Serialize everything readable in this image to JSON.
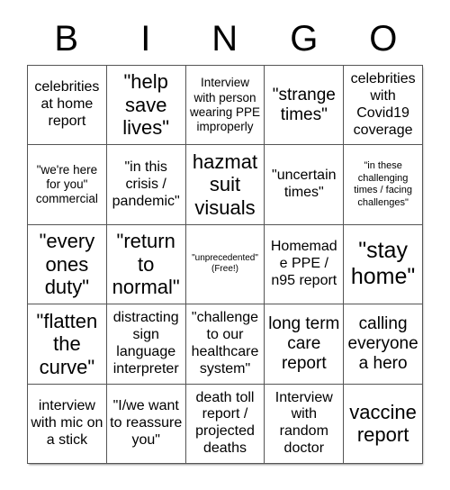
{
  "card": {
    "title": "BINGO",
    "header": {
      "letters": [
        "B",
        "I",
        "N",
        "G",
        "O"
      ]
    },
    "colors": {
      "background": "#ffffff",
      "text": "#000000",
      "border": "#555555"
    },
    "grid": {
      "columns": 5,
      "rows": 5,
      "free_space_index": 12,
      "cells": [
        {
          "text": "celebrities at home report",
          "size": "md",
          "free": false
        },
        {
          "text": "\"help save lives\"",
          "size": "xl",
          "free": false
        },
        {
          "text": "Interview with person wearing PPE improperly",
          "size": "sm",
          "free": false
        },
        {
          "text": "\"strange times\"",
          "size": "lg",
          "free": false
        },
        {
          "text": "celebrities with Covid19 coverage",
          "size": "md",
          "free": false
        },
        {
          "text": "\"we're here for you\" commercial",
          "size": "sm",
          "free": false
        },
        {
          "text": "\"in this crisis / pandemic\"",
          "size": "md",
          "free": false
        },
        {
          "text": "hazmat suit visuals",
          "size": "xl",
          "free": false
        },
        {
          "text": "\"uncertain times\"",
          "size": "md",
          "free": false
        },
        {
          "text": "\"in these challenging times / facing challenges\"",
          "size": "xs",
          "free": false
        },
        {
          "text": "\"every ones duty\"",
          "size": "xl",
          "free": false
        },
        {
          "text": "\"return to normal\"",
          "size": "xl",
          "free": false
        },
        {
          "text": "\"unprecedented\" (Free!)",
          "size": "free",
          "free": true
        },
        {
          "text": "Homemade PPE / n95 report",
          "size": "md",
          "free": false
        },
        {
          "text": "\"stay home\"",
          "size": "xxl",
          "free": false
        },
        {
          "text": "\"flatten the curve\"",
          "size": "xl",
          "free": false
        },
        {
          "text": "distracting sign language interpreter",
          "size": "md",
          "free": false
        },
        {
          "text": "\"challenge to our healthcare system\"",
          "size": "md",
          "free": false
        },
        {
          "text": "long term care report",
          "size": "lg",
          "free": false
        },
        {
          "text": "calling everyone a hero",
          "size": "lg",
          "free": false
        },
        {
          "text": "interview with mic on a stick",
          "size": "md",
          "free": false
        },
        {
          "text": "\"I/we want to reassure you\"",
          "size": "md",
          "free": false
        },
        {
          "text": "death toll report / projected deaths",
          "size": "md",
          "free": false
        },
        {
          "text": "Interview with random doctor",
          "size": "md",
          "free": false
        },
        {
          "text": "vaccine report",
          "size": "xl",
          "free": false
        }
      ]
    }
  }
}
